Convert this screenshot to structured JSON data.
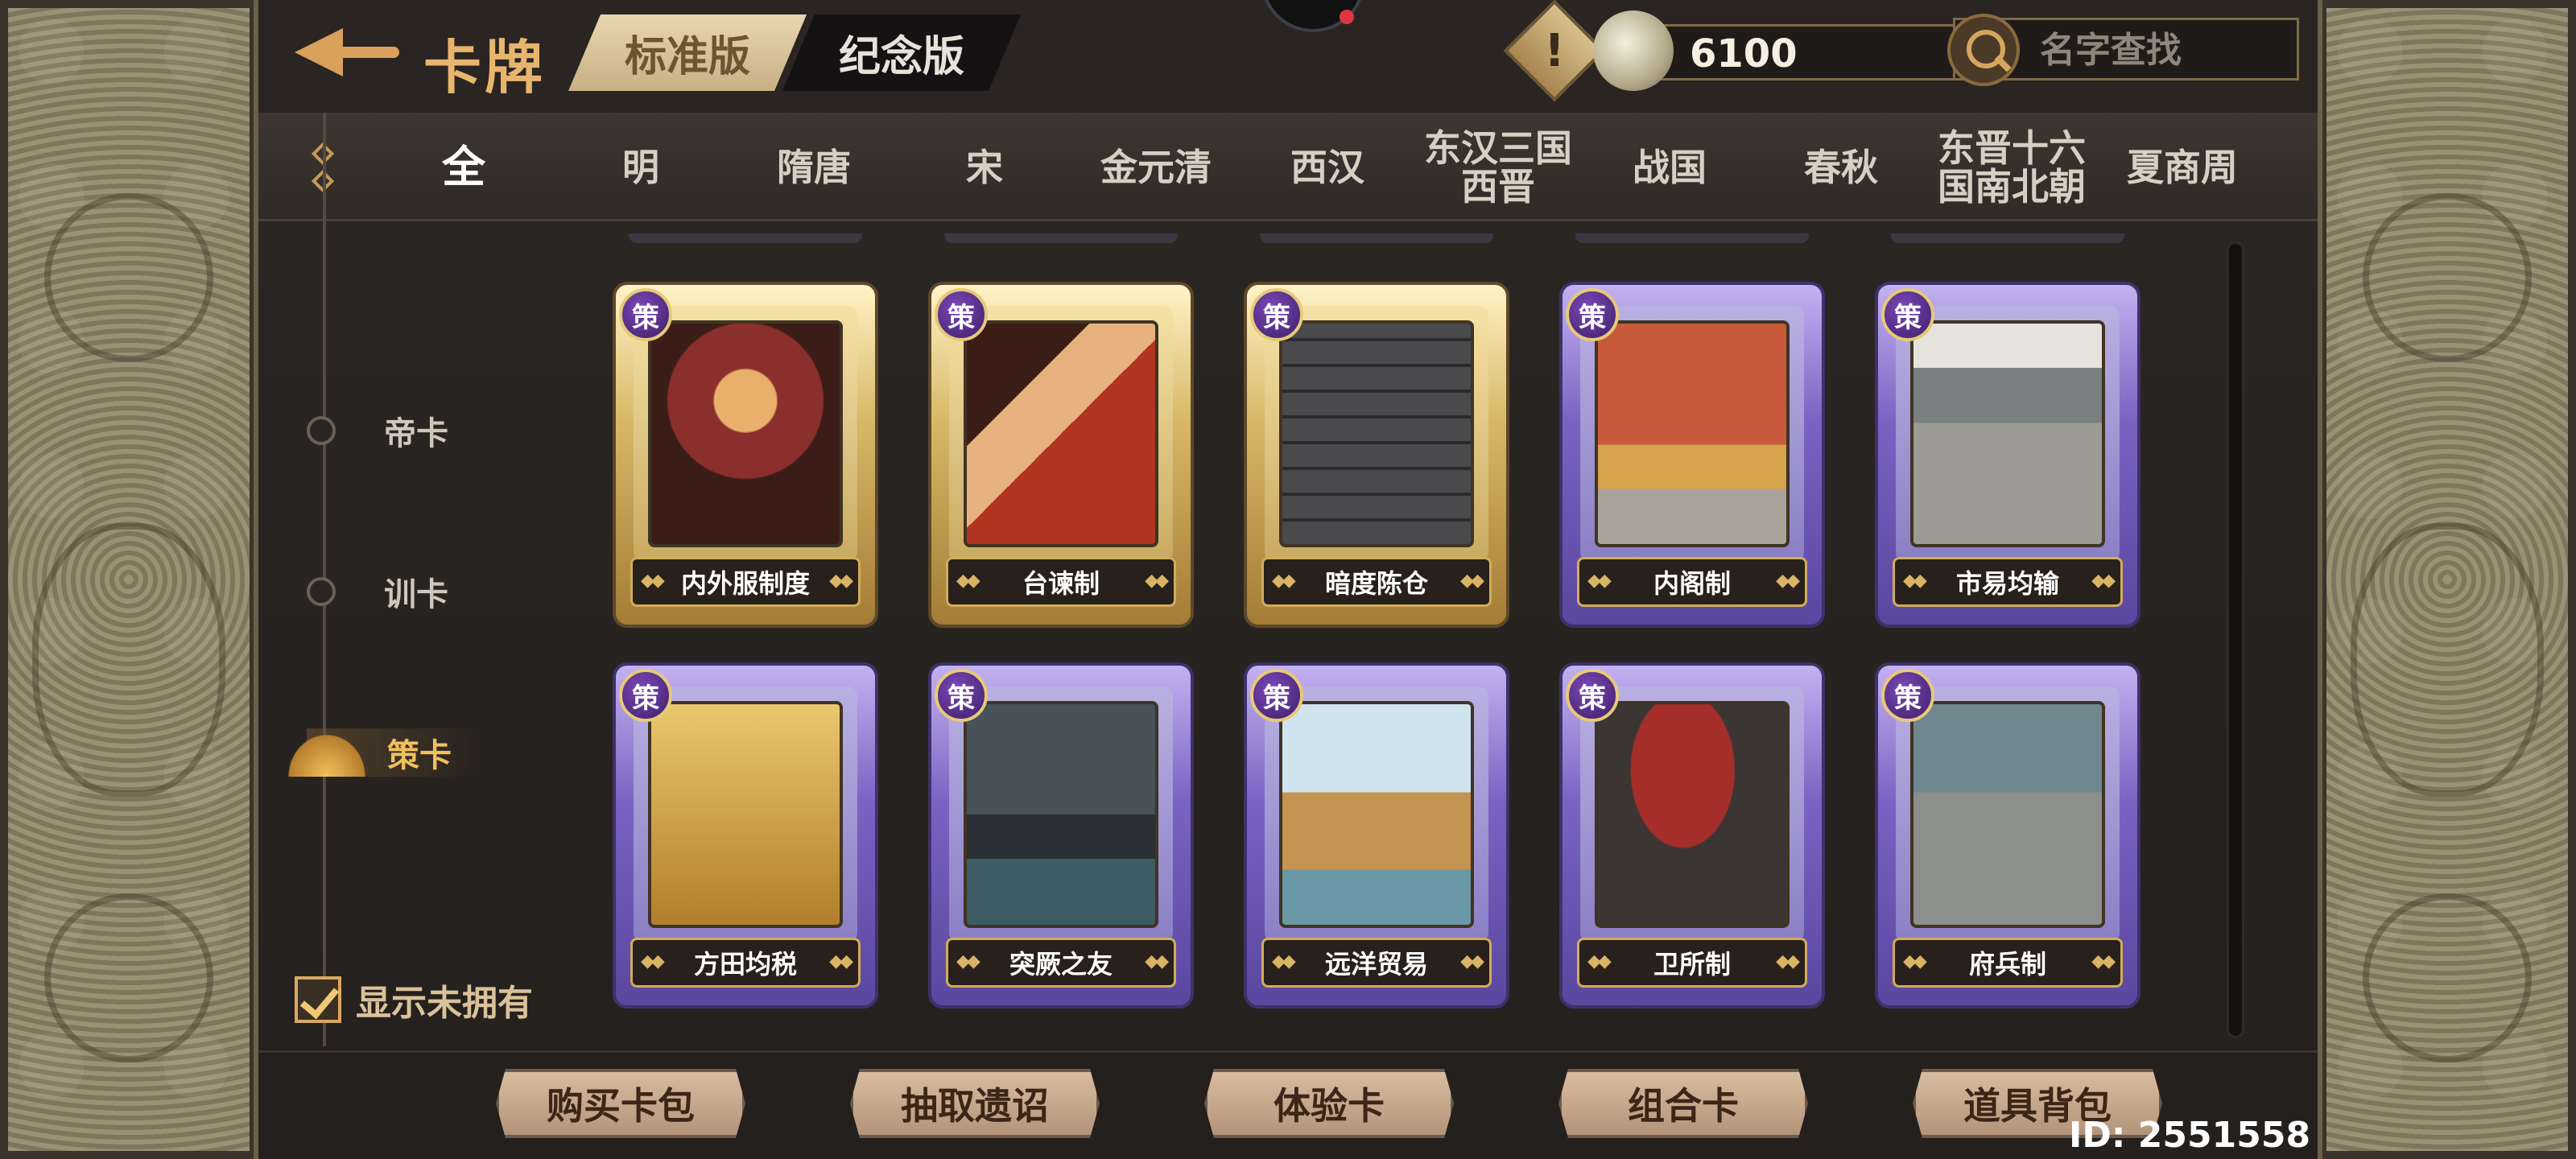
{
  "header": {
    "title": "卡牌",
    "version_tabs": [
      {
        "label": "标准版",
        "active": true
      },
      {
        "label": "纪念版",
        "active": false
      }
    ],
    "warning_glyph": "!",
    "currency_value": "6100",
    "search_placeholder": "名字查找"
  },
  "dynasty_tabs": [
    {
      "label": "全",
      "active": true
    },
    {
      "label": "明"
    },
    {
      "label": "隋唐"
    },
    {
      "label": "宋"
    },
    {
      "label": "金元清"
    },
    {
      "label": "西汉"
    },
    {
      "label": "东汉三国\n西晋"
    },
    {
      "label": "战国"
    },
    {
      "label": "春秋"
    },
    {
      "label": "东晋十六\n国南北朝"
    },
    {
      "label": "夏商周"
    }
  ],
  "categories": [
    {
      "label": "帝卡",
      "active": false
    },
    {
      "label": "训卡",
      "active": false
    },
    {
      "label": "策卡",
      "active": true
    }
  ],
  "show_unowned_label": "显示未拥有",
  "card_badge": "策",
  "cards": [
    {
      "name": "内外服制度",
      "frame": "gold",
      "icon": "court-art"
    },
    {
      "name": "台谏制",
      "frame": "gold",
      "icon": "official-art"
    },
    {
      "name": "暗度陈仓",
      "frame": "gold",
      "icon": "wall-art"
    },
    {
      "name": "内阁制",
      "frame": "purple",
      "icon": "throne-art"
    },
    {
      "name": "市易均输",
      "frame": "purple",
      "icon": "market-art"
    },
    {
      "name": "方田均税",
      "frame": "purple",
      "icon": "field-art"
    },
    {
      "name": "突厥之友",
      "frame": "purple",
      "icon": "fortress-art"
    },
    {
      "name": "远洋贸易",
      "frame": "purple",
      "icon": "ship-art"
    },
    {
      "name": "卫所制",
      "frame": "purple",
      "icon": "bow-art"
    },
    {
      "name": "府兵制",
      "frame": "purple",
      "icon": "soldier-art"
    }
  ],
  "bottom_buttons": [
    "购买卡包",
    "抽取遗诏",
    "体验卡",
    "组合卡",
    "道具背包"
  ],
  "user_id": "ID: 2551558",
  "colors": {
    "accent": "#e7b56d",
    "gold_frame": "#d8b867",
    "purple_frame": "#7a63c3"
  }
}
